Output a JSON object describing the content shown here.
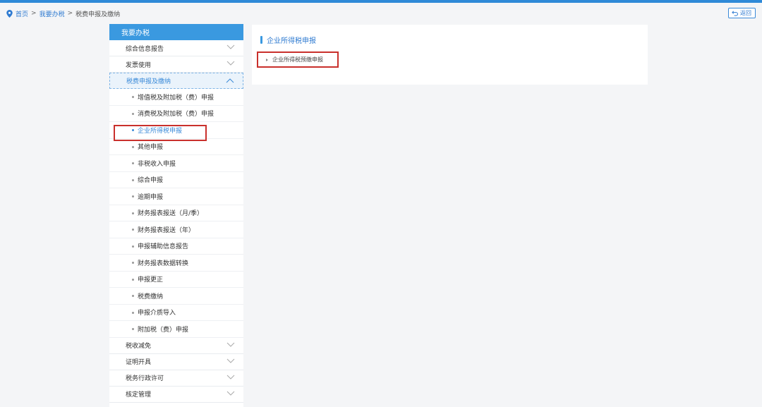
{
  "breadcrumb": {
    "home": "首页",
    "level1": "我要办税",
    "level2": "税费申报及缴纳",
    "separator": ">"
  },
  "back_button": {
    "label": "返回"
  },
  "sidebar": {
    "header": "我要办税",
    "sections_top": [
      {
        "label": "综合信息报告"
      },
      {
        "label": "发票使用"
      },
      {
        "label": "税费申报及缴纳"
      }
    ],
    "sub_items": [
      {
        "label": "增值税及附加税（费）申报"
      },
      {
        "label": "消费税及附加税（费）申报"
      },
      {
        "label": "企业所得税申报"
      },
      {
        "label": "其他申报"
      },
      {
        "label": "非税收入申报"
      },
      {
        "label": "综合申报"
      },
      {
        "label": "逾期申报"
      },
      {
        "label": "财务报表报送（月/季）"
      },
      {
        "label": "财务报表报送（年）"
      },
      {
        "label": "申报辅助信息报告"
      },
      {
        "label": "财务报表数据转换"
      },
      {
        "label": "申报更正"
      },
      {
        "label": "税费缴纳"
      },
      {
        "label": "申报介质导入"
      },
      {
        "label": "附加税（费）申报"
      }
    ],
    "sections_bottom": [
      {
        "label": "税收减免"
      },
      {
        "label": "证明开具"
      },
      {
        "label": "税务行政许可"
      },
      {
        "label": "核定管理"
      }
    ]
  },
  "panel": {
    "title": "企业所得税申报",
    "link": "企业所得税预缴申报"
  },
  "colors": {
    "accent": "#3a99e0",
    "link": "#2f7bd1",
    "highlight": "#c9302c"
  }
}
